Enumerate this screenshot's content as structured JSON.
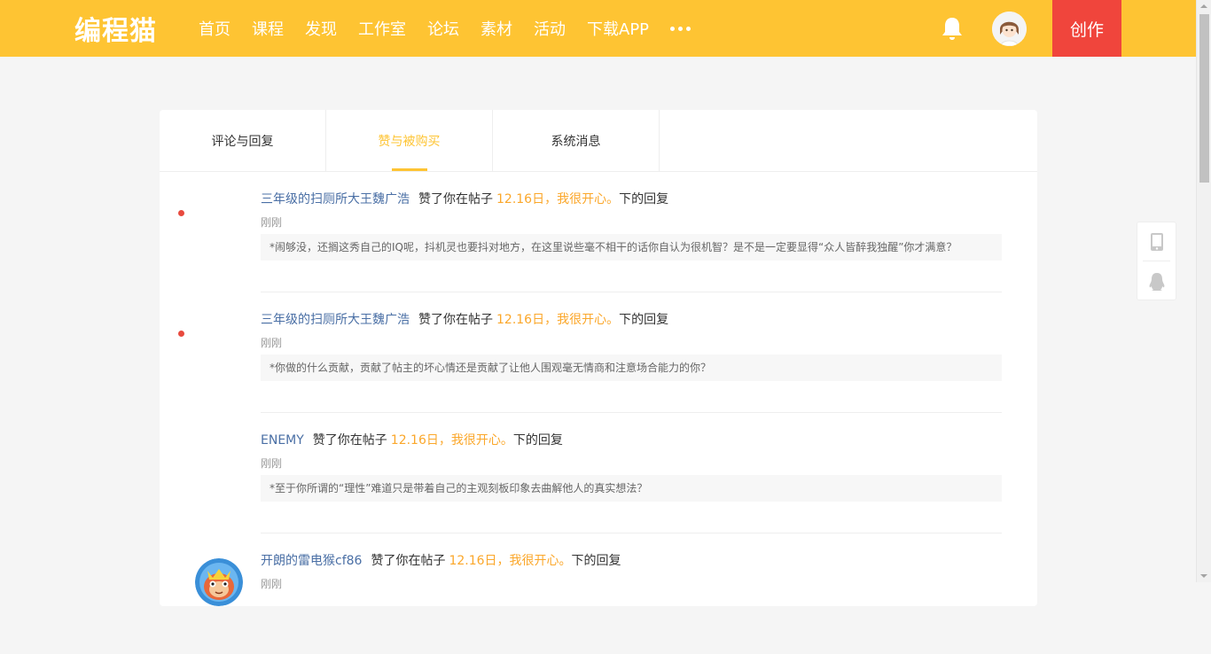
{
  "header": {
    "logo": "编程猫",
    "nav": [
      "首页",
      "课程",
      "发现",
      "工作室",
      "论坛",
      "素材",
      "活动",
      "下载APP"
    ],
    "more_icon": "more-dots-icon",
    "notification_icon": "bell-icon",
    "create_label": "创作"
  },
  "tabs": [
    {
      "label": "评论与回复",
      "active": false
    },
    {
      "label": "赞与被购买",
      "active": true
    },
    {
      "label": "系统消息",
      "active": false
    }
  ],
  "messages": [
    {
      "user": "三年级的扫厕所大王魏广浩",
      "action": "赞了你在帖子",
      "post": "12.16日，我很开心。",
      "suffix": "下的回复",
      "time": "刚刚",
      "quote": "*闹够没，还搁这秀自己的IQ呢，抖机灵也要抖对地方，在这里说些毫不相干的话你自认为很机智？是不是一定要显得“众人皆醉我独醒”你才满意？",
      "unread": true
    },
    {
      "user": "三年级的扫厕所大王魏广浩",
      "action": "赞了你在帖子",
      "post": "12.16日，我很开心。",
      "suffix": "下的回复",
      "time": "刚刚",
      "quote": "*你做的什么贡献，贡献了帖主的坏心情还是贡献了让他人围观毫无情商和注意场合能力的你？",
      "unread": true
    },
    {
      "user": "ENEMY",
      "action": "赞了你在帖子",
      "post": "12.16日，我很开心。",
      "suffix": "下的回复",
      "time": "刚刚",
      "quote": "*至于你所谓的“理性”难道只是带着自己的主观刻板印象去曲解他人的真实想法？",
      "unread": false
    },
    {
      "user": "开朗的雷电猴cf86",
      "action": "赞了你在帖子",
      "post": "12.16日，我很开心。",
      "suffix": "下的回复",
      "time": "刚刚",
      "quote": "",
      "unread": false
    }
  ],
  "side": {
    "mobile_icon": "mobile-phone-icon",
    "qq_icon": "qq-penguin-icon"
  },
  "colors": {
    "brand": "#fec433",
    "create": "#f0453c",
    "username": "#4a6fa5",
    "post_link": "#fba72a",
    "unread_dot": "#e84a3e"
  }
}
